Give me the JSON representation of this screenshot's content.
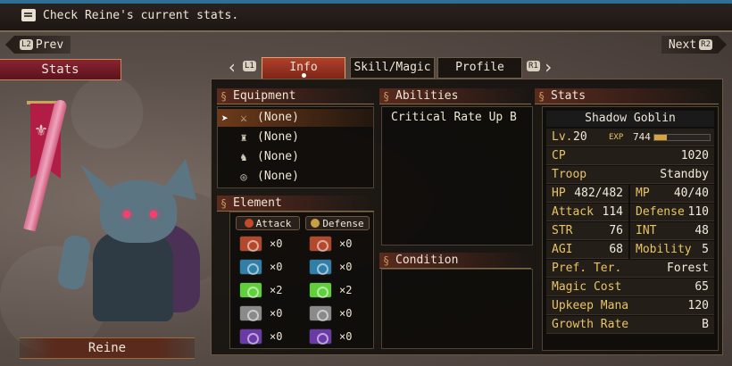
{
  "header": {
    "message": "Check Reine's current stats."
  },
  "nav": {
    "prev_label": "Prev",
    "next_label": "Next",
    "prev_button": "L2",
    "next_button": "R2"
  },
  "page_label": "Stats",
  "character": {
    "name": "Reine"
  },
  "tabs": {
    "left_button": "L1",
    "right_button": "R1",
    "items": [
      {
        "label": "Info",
        "active": true
      },
      {
        "label": "Skill/Magic",
        "active": false
      },
      {
        "label": "Profile",
        "active": false
      }
    ]
  },
  "equipment": {
    "title": "Equipment",
    "slots": [
      {
        "icon": "sword-icon",
        "value": "(None)",
        "selected": true
      },
      {
        "icon": "armor-icon",
        "value": "(None)",
        "selected": false
      },
      {
        "icon": "boot-icon",
        "value": "(None)",
        "selected": false
      },
      {
        "icon": "ring-icon",
        "value": "(None)",
        "selected": false
      }
    ]
  },
  "element": {
    "title": "Element",
    "attack_label": "Attack",
    "defense_label": "Defense",
    "rows": [
      {
        "color": "#b5482a",
        "attack": "×0",
        "defense": "×0"
      },
      {
        "color": "#2f7fa8",
        "attack": "×0",
        "defense": "×0"
      },
      {
        "color": "#5fd03a",
        "attack": "×2",
        "defense": "×2"
      },
      {
        "color": "#8a8a8a",
        "attack": "×0",
        "defense": "×0"
      },
      {
        "color": "#6b3aa8",
        "attack": "×0",
        "defense": "×0"
      }
    ]
  },
  "abilities": {
    "title": "Abilities",
    "items": [
      "Critical Rate Up B"
    ]
  },
  "condition": {
    "title": "Condition"
  },
  "stats": {
    "title": "Stats",
    "class_name": "Shadow Goblin",
    "level_label": "Lv.",
    "level": "20",
    "exp_label": "EXP",
    "exp": "744",
    "exp_fraction": 0.22,
    "cp_label": "CP",
    "cp": "1020",
    "troop_label": "Troop",
    "troop": "Standby",
    "hp_label": "HP",
    "hp": "482/482",
    "mp_label": "MP",
    "mp": "40/40",
    "attack_label": "Attack",
    "attack": "114",
    "defense_label": "Defense",
    "defense": "110",
    "str_label": "STR",
    "str": "76",
    "int_label": "INT",
    "int": "48",
    "agi_label": "AGI",
    "agi": "68",
    "mobility_label": "Mobility",
    "mobility": "5",
    "terrain_label": "Pref. Ter.",
    "terrain": "Forest",
    "magic_cost_label": "Magic Cost",
    "magic_cost": "65",
    "upkeep_label": "Upkeep Mana",
    "upkeep": "120",
    "growth_label": "Growth Rate",
    "growth": "B"
  }
}
